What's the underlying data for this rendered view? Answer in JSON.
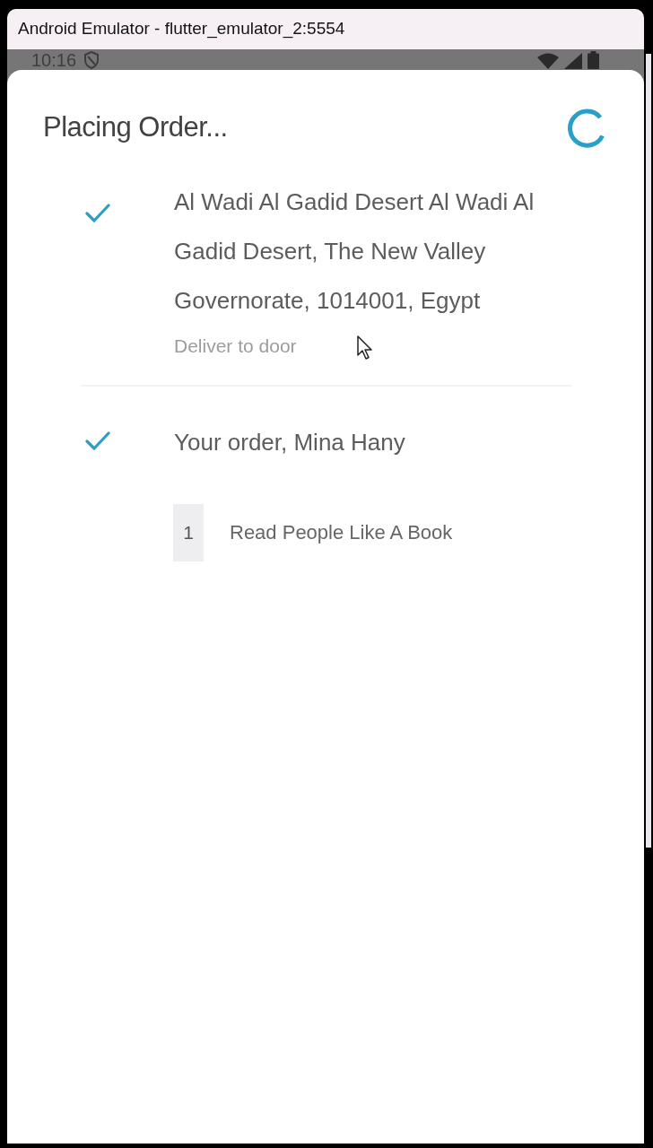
{
  "window": {
    "title": "Android Emulator - flutter_emulator_2:5554"
  },
  "status_bar": {
    "time": "10:16"
  },
  "sheet": {
    "title": "Placing Order...",
    "loading": true,
    "steps": [
      {
        "kind": "address",
        "done": true,
        "text": "Al Wadi Al Gadid Desert Al Wadi Al Gadid Desert, The New Valley Governorate, 1014001, Egypt",
        "note": "Deliver to door"
      },
      {
        "kind": "order",
        "done": true,
        "text": "Your order, Mina Hany",
        "items": [
          {
            "quantity": "1",
            "name": "Read People Like A Book"
          }
        ]
      }
    ]
  }
}
